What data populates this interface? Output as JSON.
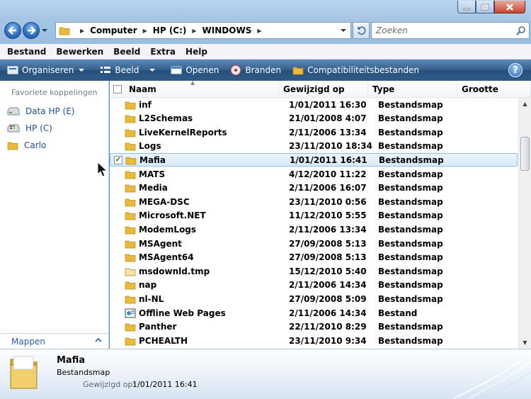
{
  "titlebar": {
    "minimize_icon": "minimize-icon",
    "maximize_icon": "maximize-icon",
    "close_icon": "close-icon"
  },
  "address_bar": {
    "breadcrumbs": [
      "Computer",
      "HP (C:)",
      "WINDOWS"
    ],
    "search_placeholder": "Zoeken"
  },
  "menu": [
    "Bestand",
    "Bewerken",
    "Beeld",
    "Extra",
    "Help"
  ],
  "commands": [
    "Organiseren",
    "Beeld",
    "Openen",
    "Branden",
    "Compatibiliteitsbestanden"
  ],
  "help_label": "?",
  "nav_pane": {
    "heading": "Favoriete koppelingen",
    "links": [
      "Data HP (E)",
      "HP (C)",
      "Carlo"
    ],
    "footer": "Mappen"
  },
  "columns": [
    "Naam",
    "Gewijzigd op",
    "Type",
    "Grootte"
  ],
  "files": [
    {
      "name": "inf",
      "date": "1/01/2011 16:30",
      "type": "Bestandsmap",
      "icon": "folder"
    },
    {
      "name": "L2Schemas",
      "date": "21/01/2008 4:07",
      "type": "Bestandsmap",
      "icon": "folder"
    },
    {
      "name": "LiveKernelReports",
      "date": "2/11/2006 13:34",
      "type": "Bestandsmap",
      "icon": "folder"
    },
    {
      "name": "Logs",
      "date": "23/11/2010 18:34",
      "type": "Bestandsmap",
      "icon": "folder"
    },
    {
      "name": "Mafia",
      "date": "1/01/2011 16:41",
      "type": "Bestandsmap",
      "icon": "folder",
      "selected": true
    },
    {
      "name": "MATS",
      "date": "4/12/2010 11:22",
      "type": "Bestandsmap",
      "icon": "folder"
    },
    {
      "name": "Media",
      "date": "2/11/2006 16:07",
      "type": "Bestandsmap",
      "icon": "folder"
    },
    {
      "name": "MEGA-DSC",
      "date": "23/11/2010 0:56",
      "type": "Bestandsmap",
      "icon": "folder"
    },
    {
      "name": "Microsoft.NET",
      "date": "11/12/2010 5:55",
      "type": "Bestandsmap",
      "icon": "folder"
    },
    {
      "name": "ModemLogs",
      "date": "2/11/2006 13:34",
      "type": "Bestandsmap",
      "icon": "folder"
    },
    {
      "name": "MSAgent",
      "date": "27/09/2008 5:13",
      "type": "Bestandsmap",
      "icon": "folder"
    },
    {
      "name": "MSAgent64",
      "date": "27/09/2008 5:13",
      "type": "Bestandsmap",
      "icon": "folder"
    },
    {
      "name": "msdownld.tmp",
      "date": "15/12/2010 5:40",
      "type": "Bestandsmap",
      "icon": "folder-light"
    },
    {
      "name": "nap",
      "date": "2/11/2006 14:34",
      "type": "Bestandsmap",
      "icon": "folder"
    },
    {
      "name": "nl-NL",
      "date": "27/09/2008 5:09",
      "type": "Bestandsmap",
      "icon": "folder"
    },
    {
      "name": "Offline Web Pages",
      "date": "2/11/2006 14:34",
      "type": "Bestand",
      "icon": "offline-pages"
    },
    {
      "name": "Panther",
      "date": "22/11/2010 8:29",
      "type": "Bestandsmap",
      "icon": "folder"
    },
    {
      "name": "PCHEALTH",
      "date": "23/11/2010 9:34",
      "type": "Bestandsmap",
      "icon": "folder"
    }
  ],
  "details": {
    "name": "Mafia",
    "type": "Bestandsmap",
    "modified_label": "Gewijzigd op:",
    "modified_value": "1/01/2011 16:41"
  },
  "colors": {
    "accent": "#2b67b5",
    "command_bar": "#34608f",
    "selection": "#d9ecfc",
    "folder": "#e8b93a"
  }
}
